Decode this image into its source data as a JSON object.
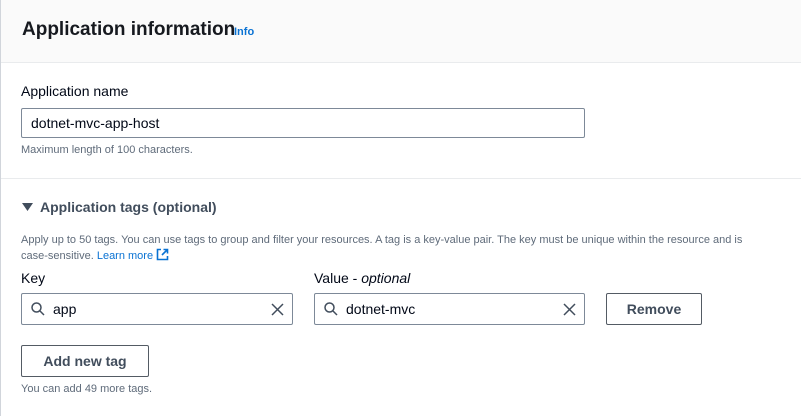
{
  "header": {
    "title": "Application information",
    "info_link": "Info"
  },
  "app_name": {
    "label": "Application name",
    "value": "dotnet-mvc-app-host",
    "hint": "Maximum length of 100 characters."
  },
  "tags": {
    "section_title": "Application tags (optional)",
    "description": "Apply up to 50 tags. You can use tags to group and filter your resources. A tag is a key-value pair. The key must be unique within the resource and is case-sensitive.",
    "learn_more": "Learn more",
    "key_label": "Key",
    "value_label": "Value - ",
    "value_label_optional": "optional",
    "rows": [
      {
        "key": "app",
        "value": "dotnet-mvc",
        "remove_label": "Remove"
      }
    ],
    "add_button": "Add new tag",
    "footer": "You can add 49 more tags."
  },
  "colors": {
    "link": "#0972d3",
    "text": "#000716",
    "muted": "#5f6b7a"
  }
}
